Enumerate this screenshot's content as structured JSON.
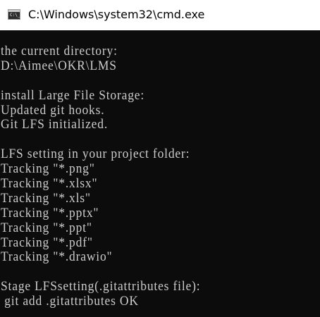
{
  "window": {
    "title": "C:\\Windows\\system32\\cmd.exe",
    "icon": "cmd-icon",
    "icon_glyph": "C:\\_"
  },
  "colors": {
    "titlebar_bg": "#ffffff",
    "console_bg": "#0c0c0c",
    "console_text": "#cccccc"
  },
  "console": {
    "lines": [
      "the current directory:",
      "D:\\Aimee\\OKR\\LMS",
      "",
      "install Large File Storage:",
      "Updated git hooks.",
      "Git LFS initialized.",
      "",
      "LFS setting in your project folder:",
      "Tracking \"*.png\"",
      "Tracking \"*.xlsx\"",
      "Tracking \"*.xls\"",
      "Tracking \"*.pptx\"",
      "Tracking \"*.ppt\"",
      "Tracking \"*.pdf\"",
      "Tracking \"*.drawio\"",
      "",
      "Stage LFSsetting(.gitattributes file):",
      " git add .gitattributes OK"
    ]
  }
}
